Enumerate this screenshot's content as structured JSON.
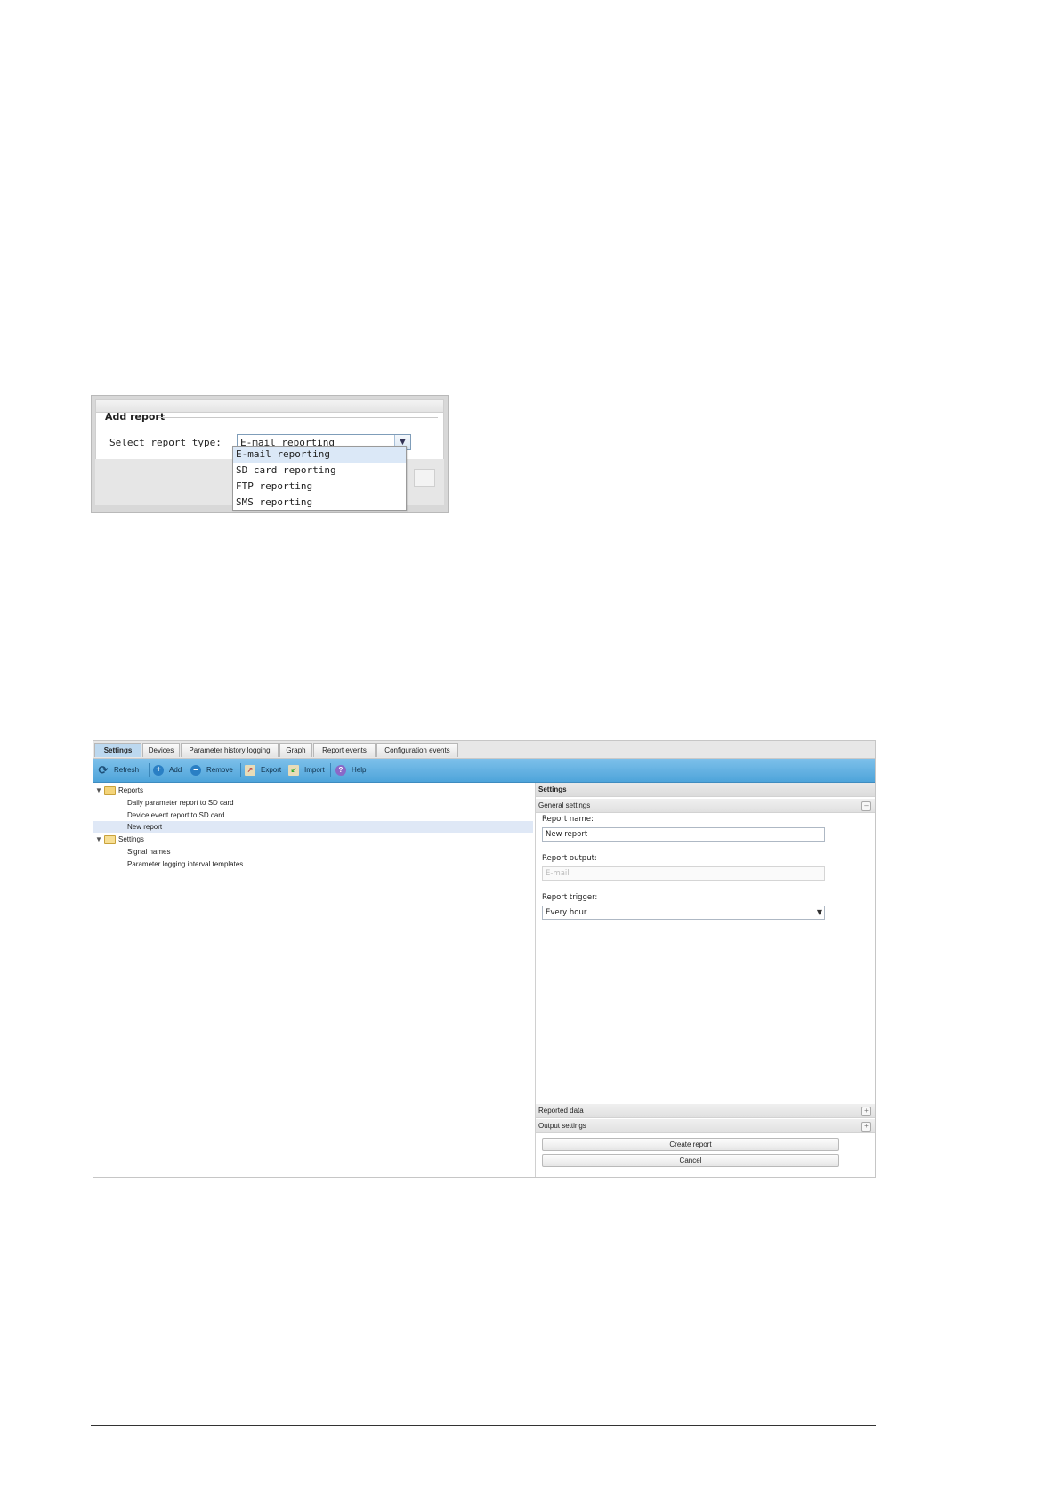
{
  "add_dialog": {
    "title": "Add report",
    "select_label": "Select report type:",
    "selected_value": "E-mail reporting",
    "options": [
      "E-mail reporting",
      "SD card reporting",
      "FTP reporting",
      "SMS reporting"
    ]
  },
  "app": {
    "tabs": [
      "Settings",
      "Devices",
      "Parameter history logging",
      "Graph",
      "Report events",
      "Configuration events"
    ],
    "active_tab": "Settings",
    "toolbar": {
      "refresh": "Refresh",
      "add": "Add",
      "remove": "Remove",
      "export": "Export",
      "import": "Import",
      "help": "Help"
    },
    "tree": {
      "reports_folder": "Reports",
      "reports": [
        "Daily parameter report to SD card",
        "Device event report to SD card",
        "New report"
      ],
      "settings_folder": "Settings",
      "settings": [
        "Signal names",
        "Parameter logging interval templates"
      ]
    },
    "settings_panel": {
      "header": "Settings",
      "general_settings": "General settings",
      "report_name_label": "Report name:",
      "report_name_value": "New report",
      "report_output_label": "Report output:",
      "report_output_value": "E-mail",
      "report_trigger_label": "Report trigger:",
      "report_trigger_value": "Every hour",
      "reported_data": "Reported data",
      "output_settings": "Output settings",
      "create_button": "Create report",
      "cancel_button": "Cancel"
    }
  },
  "colors": {
    "toolbar": "#5aaee0",
    "active_tab": "#bcd8ef",
    "selection": "#dfe8f6"
  }
}
